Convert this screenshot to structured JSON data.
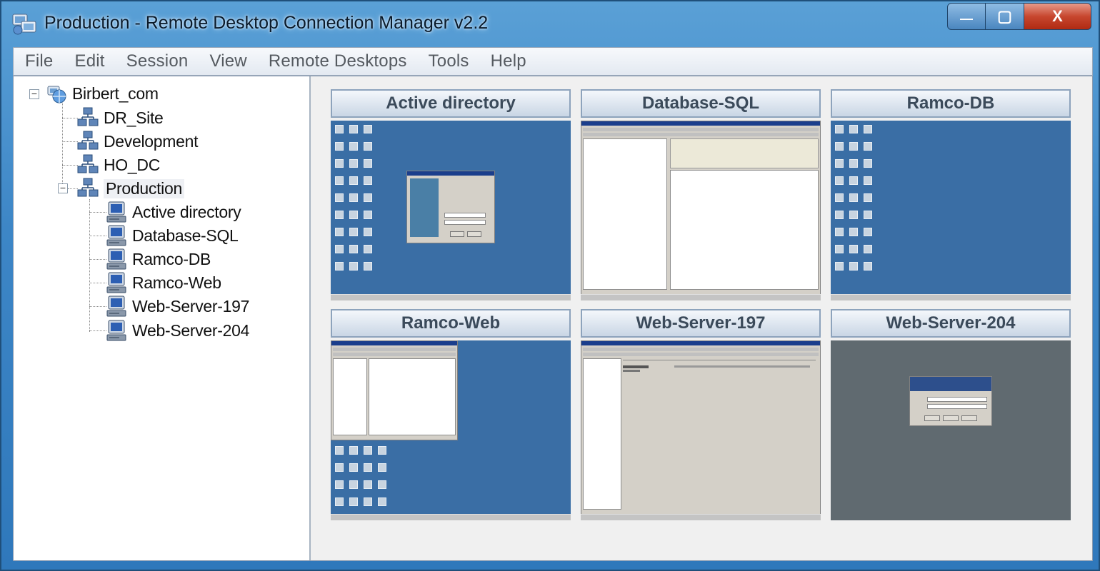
{
  "window": {
    "title": "Production - Remote Desktop Connection Manager v2.2",
    "controls": {
      "minimize": "—",
      "maximize": "▢",
      "close": "X"
    }
  },
  "menu": [
    "File",
    "Edit",
    "Session",
    "View",
    "Remote Desktops",
    "Tools",
    "Help"
  ],
  "tree": {
    "root": "Birbert_com",
    "groups": [
      "DR_Site",
      "Development",
      "HO_DC",
      "Production"
    ],
    "servers": [
      "Active directory",
      "Database-SQL",
      "Ramco-DB",
      "Ramco-Web",
      "Web-Server-197",
      "Web-Server-204"
    ]
  },
  "thumbnails": [
    {
      "title": "Active directory",
      "desktop": "blue",
      "content": "login-dialog"
    },
    {
      "title": "Database-SQL",
      "desktop": "blue",
      "content": "sql-manager"
    },
    {
      "title": "Ramco-DB",
      "desktop": "blue",
      "content": "icons-only"
    },
    {
      "title": "Ramco-Web",
      "desktop": "blue",
      "content": "explorer-window"
    },
    {
      "title": "Web-Server-197",
      "desktop": "blue",
      "content": "iis-manager"
    },
    {
      "title": "Web-Server-204",
      "desktop": "gray",
      "content": "logon-screen"
    }
  ],
  "colors": {
    "desktop_blue": "#3a6ea5",
    "desktop_gray": "#606a70",
    "title_blue": "#3d86c6"
  }
}
